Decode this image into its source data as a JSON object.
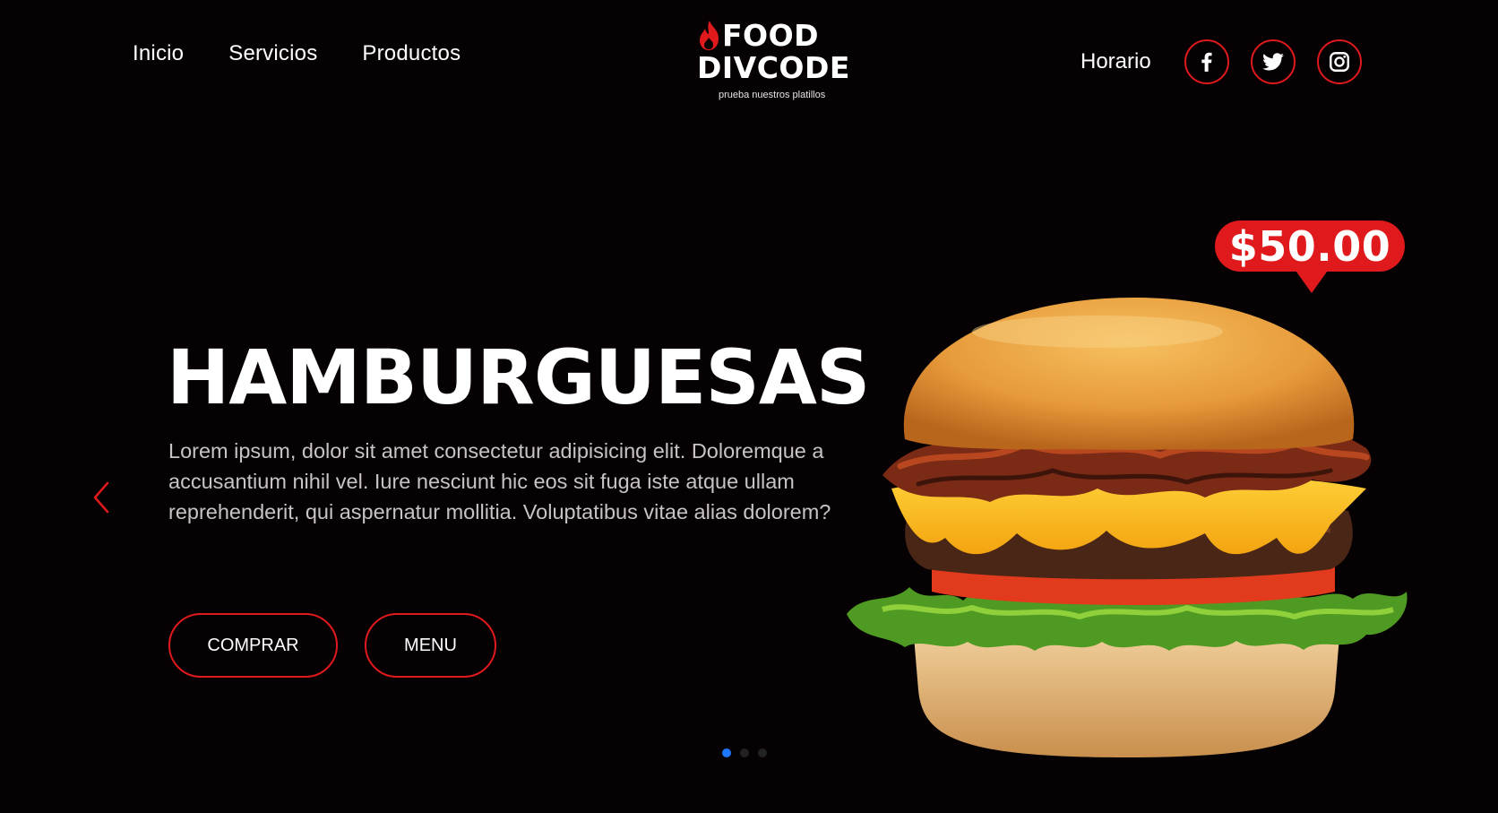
{
  "nav": {
    "links": [
      "Inicio",
      "Servicios",
      "Productos"
    ],
    "horario": "Horario"
  },
  "logo": {
    "line1": "FOOD",
    "line2": "DIVCODE",
    "tagline": "prueba nuestros platillos"
  },
  "social": {
    "icons": [
      "facebook-icon",
      "twitter-icon",
      "instagram-icon"
    ]
  },
  "hero": {
    "title": "HAMBURGUESAS",
    "description": "Lorem ipsum, dolor sit amet consectetur adipisicing elit. Doloremque a accusantium nihil vel. Iure nesciunt hic eos sit fuga iste atque ullam reprehenderit, qui aspernatur mollitia. Voluptatibus vitae alias dolorem?",
    "buy_label": "COMPRAR",
    "menu_label": "MENU",
    "price": "$50.00"
  },
  "slider": {
    "active_index": 0
  },
  "colors": {
    "accent": "#e0191d",
    "background": "#060203",
    "dot_active": "#1e78ff"
  }
}
